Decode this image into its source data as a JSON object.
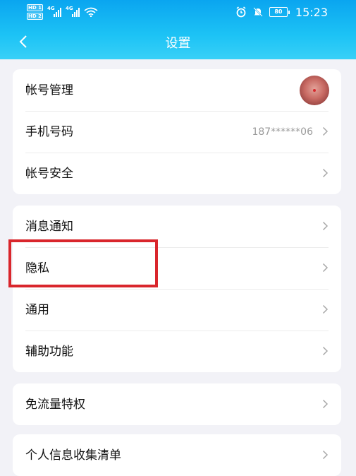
{
  "status_bar": {
    "hd_badges": [
      "HD 1",
      "HD 2"
    ],
    "signal_tags": [
      "4G",
      "4G"
    ],
    "battery": "80",
    "time": "15:23",
    "icons": [
      "alarm-icon",
      "mute-icon",
      "battery-icon"
    ]
  },
  "nav": {
    "title": "设置",
    "back_icon": "chevron-left-icon"
  },
  "groups": [
    {
      "items": [
        {
          "label": "帐号管理",
          "value": "",
          "avatar": true
        },
        {
          "label": "手机号码",
          "value": "187******06"
        },
        {
          "label": "帐号安全",
          "value": ""
        }
      ]
    },
    {
      "items": [
        {
          "label": "消息通知",
          "value": ""
        },
        {
          "label": "隐私",
          "value": "",
          "highlighted": true
        },
        {
          "label": "通用",
          "value": ""
        },
        {
          "label": "辅助功能",
          "value": ""
        }
      ]
    },
    {
      "items": [
        {
          "label": "免流量特权",
          "value": ""
        }
      ]
    },
    {
      "items": [
        {
          "label": "个人信息收集清单",
          "value": ""
        }
      ]
    }
  ],
  "colors": {
    "header_top": "#0aa5f0",
    "header_bottom": "#38d0f7",
    "page_bg": "#f2f2f7",
    "highlight": "#d9262c"
  }
}
